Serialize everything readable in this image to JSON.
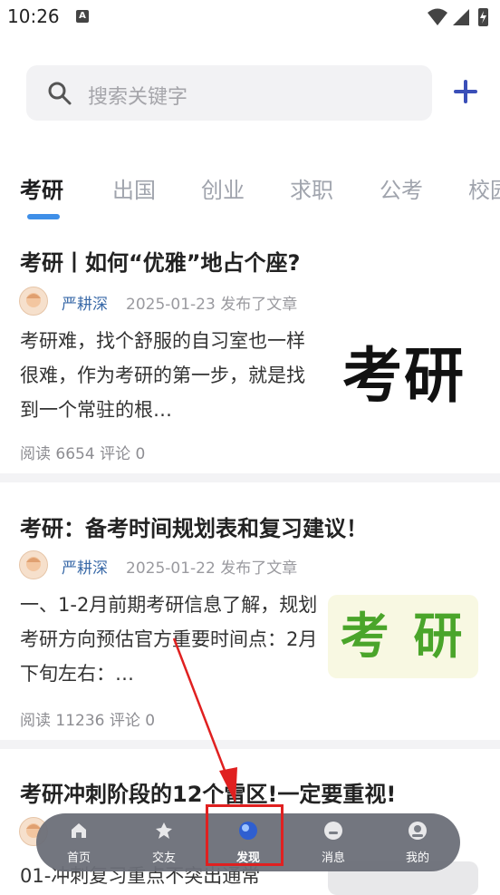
{
  "status_bar": {
    "time": "10:26",
    "notif_letter": "A"
  },
  "search": {
    "placeholder": "搜索关键字"
  },
  "tabs": [
    {
      "label": "考研",
      "active": true
    },
    {
      "label": "出国",
      "active": false
    },
    {
      "label": "创业",
      "active": false
    },
    {
      "label": "求职",
      "active": false
    },
    {
      "label": "公考",
      "active": false
    },
    {
      "label": "校园",
      "active": false
    }
  ],
  "articles": [
    {
      "title": "考研丨如何“优雅”地占个座?",
      "author": "严耕深",
      "meta": "2025-01-23 发布了文章",
      "summary": "考研难，找个舒服的自习室也一样很难，作为考研的第一步，就是找到一个常驻的根…",
      "stats": "阅读 6654  评论 0",
      "thumb_text": "考研"
    },
    {
      "title": "考研：备考时间规划表和复习建议！",
      "author": "严耕深",
      "meta": "2025-01-22 发布了文章",
      "summary": " 一、1-2月前期考研信息了解，规划考研方向预估官方重要时间点：2月下旬左右：…",
      "stats": "阅读 11236  评论 0",
      "thumb_text": "考 研"
    },
    {
      "title": "考研冲刺阶段的12个雷区!一定要重视!",
      "summary": "01-冲刺复习重点不突出通常"
    }
  ],
  "bottom_nav": [
    {
      "label": "首页",
      "icon": "home-icon"
    },
    {
      "label": "交友",
      "icon": "friends-icon"
    },
    {
      "label": "发现",
      "icon": "discover-icon",
      "active": true
    },
    {
      "label": "消息",
      "icon": "message-icon"
    },
    {
      "label": "我的",
      "icon": "profile-icon"
    }
  ],
  "colors": {
    "accent": "#3f8fe8",
    "plus": "#3a4fb8",
    "highlight": "#e02020"
  }
}
